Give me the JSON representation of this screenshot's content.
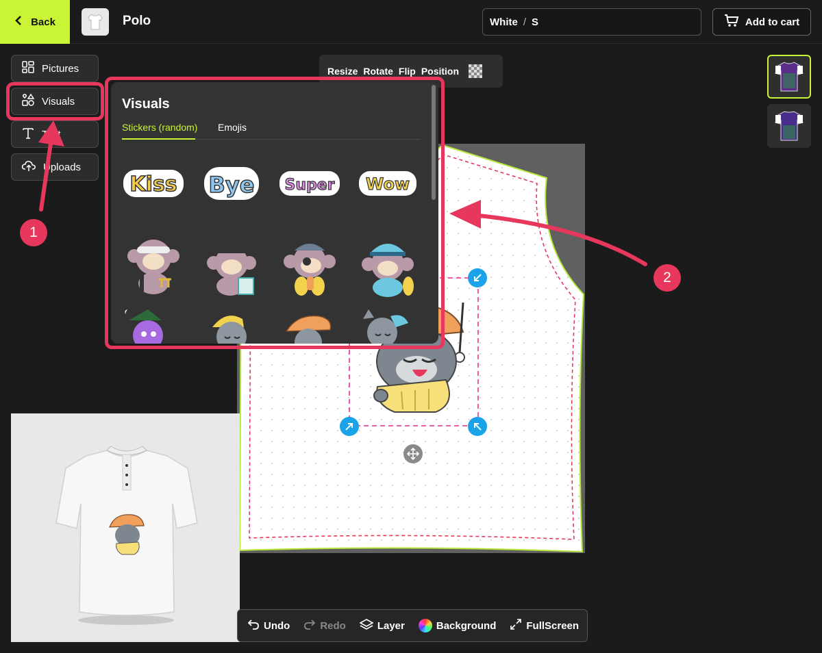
{
  "header": {
    "back_label": "Back",
    "product_name": "Polo",
    "variant": {
      "color": "White",
      "separator": "/",
      "size": "S"
    },
    "add_to_cart_label": "Add to cart"
  },
  "tools": [
    {
      "label": "Pictures",
      "icon": "grid-icon"
    },
    {
      "label": "Visuals",
      "icon": "shapes-icon"
    },
    {
      "label": "Text",
      "icon": "text-icon"
    },
    {
      "label": "Uploads",
      "icon": "cloud-upload-icon"
    }
  ],
  "transform_toolbar": {
    "resize": "Resize",
    "rotate": "Rotate",
    "flip": "Flip",
    "position": "Position"
  },
  "visuals_panel": {
    "title": "Visuals",
    "tabs": [
      {
        "label": "Stickers (random)",
        "active": true
      },
      {
        "label": "Emojis",
        "active": false
      }
    ],
    "stickers": [
      "Kiss",
      "Bye",
      "Super",
      "Wow"
    ]
  },
  "bottom_toolbar": {
    "undo": "Undo",
    "redo": "Redo",
    "layer": "Layer",
    "background": "Background",
    "fullscreen": "FullScreen"
  },
  "annotations": {
    "step1": "1",
    "step2": "2"
  },
  "colors": {
    "accent": "#c9f536",
    "highlight": "#e8375c",
    "handle": "#1aa3e8"
  }
}
